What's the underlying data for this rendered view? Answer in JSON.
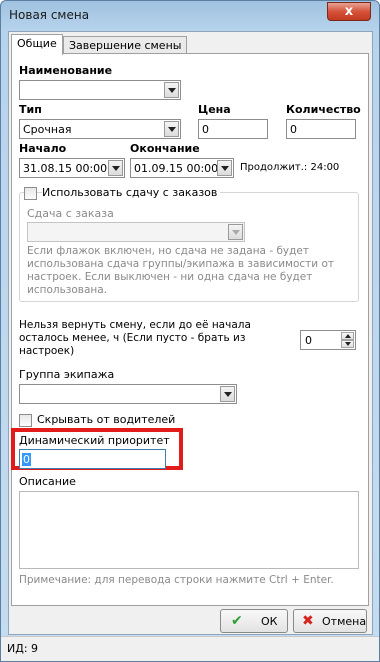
{
  "window": {
    "title": "Новая смена",
    "close_glyph": "x"
  },
  "tabs": [
    {
      "label": "Общие",
      "active": true
    },
    {
      "label": "Завершение смены",
      "active": false
    }
  ],
  "form": {
    "name_label": "Наименование",
    "name_value": "",
    "type_label": "Тип",
    "type_value": "Срочная",
    "price_label": "Цена",
    "price_value": "0",
    "qty_label": "Количество",
    "qty_value": "0",
    "start_label": "Начало",
    "start_value": "31.08.15 00:00",
    "end_label": "Окончание",
    "end_value": "01.09.15 00:00",
    "duration_text": "Продолжит.: 24:00",
    "use_order_checkbox": {
      "label": "Использовать сдачу с заказов",
      "checked": false
    },
    "order_change_label": "Сдача с заказа",
    "order_change_value": "",
    "order_change_hint": "Если флажок включен, но сдача не задана - будет использована сдача группы/экипажа в зависимости от настроек. Если выключен - ни одна сдача не будет использована.",
    "cannot_return_text": "Нельзя вернуть смену, если до её начала осталось менее, ч (Если пусто - брать из настроек)",
    "cannot_return_value": "0",
    "crew_group_label": "Группа экипажа",
    "crew_group_value": "",
    "hide_from_drivers": {
      "label": "Скрывать от водителей",
      "checked": false
    },
    "dynamic_priority_label": "Динамический приоритет",
    "dynamic_priority_value": "0",
    "description_label": "Описание",
    "description_value": "",
    "note_text": "Примечание: для перевода строки нажмите Ctrl + Enter."
  },
  "buttons": {
    "ok_label": "ОК",
    "cancel_label": "Отмена"
  },
  "status": {
    "id_text": "ИД: 9"
  },
  "colors": {
    "highlight": "#e21b1b",
    "ok_icon": "#2e9e2e",
    "cancel_icon": "#d4251e"
  },
  "icons": {
    "ok": "checkmark-icon",
    "cancel": "cross-icon"
  }
}
